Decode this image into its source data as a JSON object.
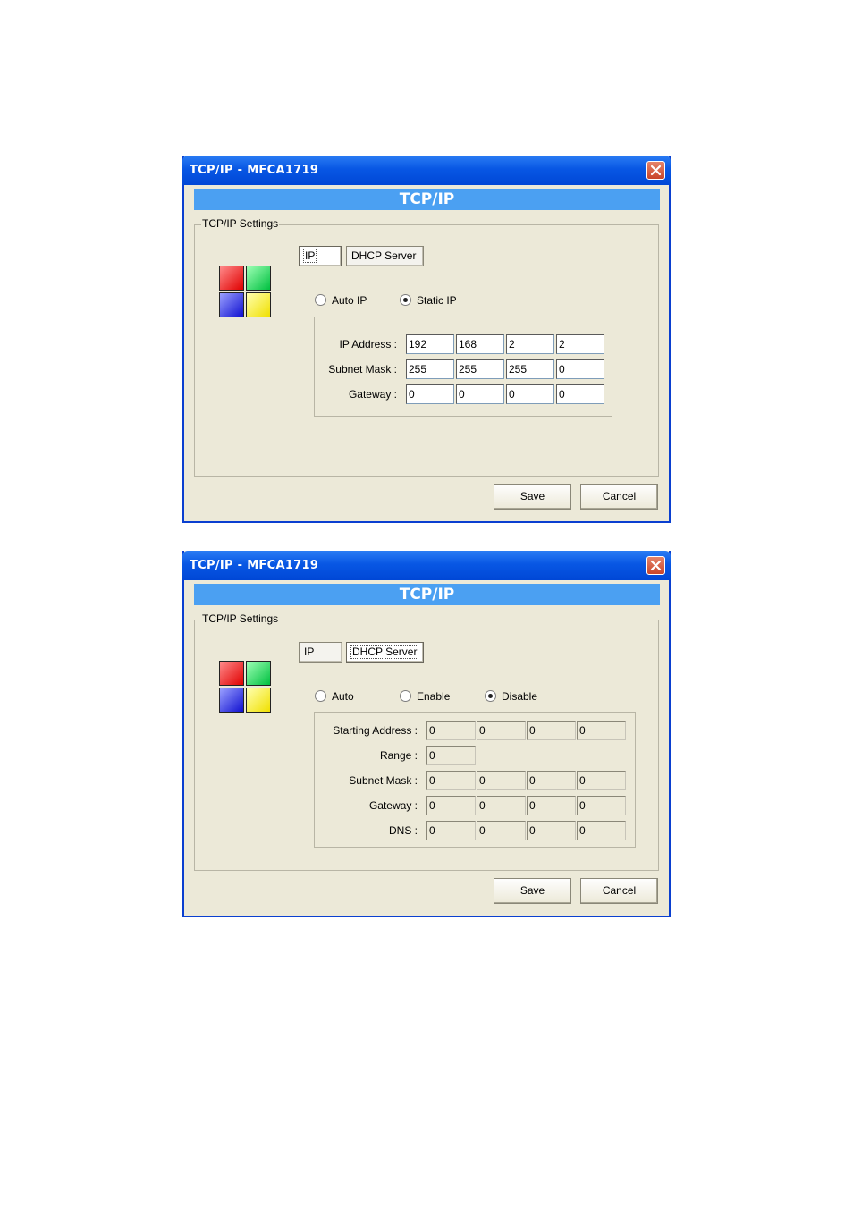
{
  "dialog1": {
    "title": "TCP/IP - MFCA1719",
    "banner": "TCP/IP",
    "group_label": "TCP/IP Settings",
    "tabs": [
      {
        "label": "IP",
        "active": true
      },
      {
        "label": "DHCP Server",
        "active": false
      }
    ],
    "radios": [
      {
        "label": "Auto IP",
        "checked": false
      },
      {
        "label": "Static IP",
        "checked": true
      }
    ],
    "rows": [
      {
        "label": "IP Address :",
        "values": [
          "192",
          "168",
          "2",
          "2"
        ]
      },
      {
        "label": "Subnet Mask :",
        "values": [
          "255",
          "255",
          "255",
          "0"
        ]
      },
      {
        "label": "Gateway :",
        "values": [
          "0",
          "0",
          "0",
          "0"
        ]
      }
    ],
    "save_label": "Save",
    "cancel_label": "Cancel"
  },
  "dialog2": {
    "title": "TCP/IP - MFCA1719",
    "banner": "TCP/IP",
    "group_label": "TCP/IP Settings",
    "tabs": [
      {
        "label": "IP",
        "active": false
      },
      {
        "label": "DHCP Server",
        "active": true
      }
    ],
    "radios": [
      {
        "label": "Auto",
        "checked": false
      },
      {
        "label": "Enable",
        "checked": false
      },
      {
        "label": "Disable",
        "checked": true
      }
    ],
    "rows": [
      {
        "label": "Starting Address :",
        "values": [
          "0",
          "0",
          "0",
          "0"
        ]
      },
      {
        "label": "Range :",
        "values": [
          "0"
        ]
      },
      {
        "label": "Subnet Mask :",
        "values": [
          "0",
          "0",
          "0",
          "0"
        ]
      },
      {
        "label": "Gateway :",
        "values": [
          "0",
          "0",
          "0",
          "0"
        ]
      },
      {
        "label": "DNS :",
        "values": [
          "0",
          "0",
          "0",
          "0"
        ]
      }
    ],
    "save_label": "Save",
    "cancel_label": "Cancel"
  },
  "logo_text": "TCP/IP",
  "colors": {
    "titlebar": "#0857e4",
    "banner": "#4ba0f2",
    "dialog_bg": "#ece9d8",
    "close": "#c9452a"
  }
}
